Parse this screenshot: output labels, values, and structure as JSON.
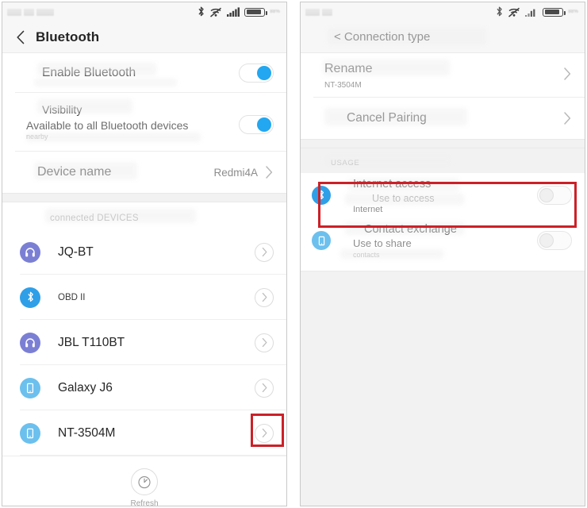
{
  "left_phone": {
    "statusbar": {
      "battery_percent": "88%",
      "icons": [
        "bluetooth-icon",
        "wifi-off-icon",
        "signal-bars-icon",
        "battery-icon"
      ]
    },
    "header": {
      "back": "back-chevron-icon",
      "title": "Bluetooth"
    },
    "settings": [
      {
        "title": "Enable Bluetooth",
        "subtitle": "",
        "subtitle2": "",
        "toggle": "on"
      },
      {
        "title": "Visibility",
        "subtitle": "Available to all Bluetooth devices",
        "subtitle2": "nearby",
        "toggle": "on"
      }
    ],
    "device_name_row": {
      "label": "Device name",
      "value": "Redmi4A"
    },
    "section_header": "connected DEVICES",
    "devices": [
      {
        "name": "JQ-BT",
        "icon": "headset-icon",
        "highlighted": false,
        "small": false
      },
      {
        "name": "OBD II",
        "icon": "bluetooth-icon",
        "highlighted": false,
        "small": true
      },
      {
        "name": "JBL T110BT",
        "icon": "headset-icon",
        "highlighted": false,
        "small": false
      },
      {
        "name": "Galaxy J6",
        "icon": "phone-icon",
        "highlighted": false,
        "small": false
      },
      {
        "name": "NT-3504M",
        "icon": "phone-icon",
        "highlighted": true,
        "small": false
      }
    ],
    "refresh": {
      "label": "Refresh",
      "icon": "scan-refresh-icon"
    }
  },
  "right_phone": {
    "statusbar": {
      "battery_percent": "88%",
      "icons": [
        "bluetooth-icon",
        "wifi-off-icon",
        "signal-bars-icon",
        "battery-icon"
      ]
    },
    "header": {
      "title": "< Connection type"
    },
    "actions": [
      {
        "title": "Rename",
        "subtitle": "NT-3504M"
      },
      {
        "title": "Cancel Pairing",
        "subtitle": ""
      }
    ],
    "usage_header": "USAGE",
    "usage_items": [
      {
        "title": "Internet access",
        "subtitle": "Use to access",
        "subtitle2": "Internet",
        "icon": "bluetooth-icon",
        "toggle": "off",
        "highlighted": true
      },
      {
        "title": "Contact exchange",
        "subtitle": "Use to share",
        "subtitle2": "contacts",
        "icon": "phone-icon",
        "toggle": "off",
        "highlighted": false
      }
    ]
  },
  "annotation": {
    "color": "#cc2027"
  }
}
